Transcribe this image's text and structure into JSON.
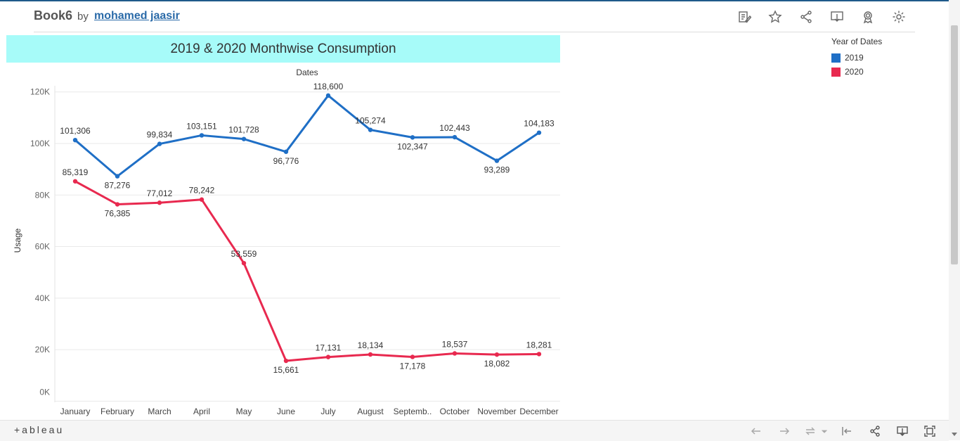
{
  "header": {
    "title": "Book6",
    "by": "by",
    "author": "mohamed jaasir"
  },
  "footer": {
    "logo_text": "+ableau"
  },
  "chart_data": {
    "type": "line",
    "title": "2019 & 2020 Monthwise Consumption",
    "xlabel": "Dates",
    "ylabel": "Usage",
    "categories": [
      "January",
      "February",
      "March",
      "April",
      "May",
      "June",
      "July",
      "August",
      "Septemb..",
      "October",
      "November",
      "December"
    ],
    "ylim": [
      0,
      120000
    ],
    "yticks": [
      0,
      20000,
      40000,
      60000,
      80000,
      100000,
      120000
    ],
    "ytick_labels": [
      "0K",
      "20K",
      "40K",
      "60K",
      "80K",
      "100K",
      "120K"
    ],
    "grid": true,
    "legend_title": "Year of Dates",
    "legend_position": "top-right",
    "series": [
      {
        "name": "2019",
        "color": "#1f6fc6",
        "values": [
          101306,
          87276,
          99834,
          103151,
          101728,
          96776,
          118600,
          105274,
          102347,
          102443,
          93289,
          104183
        ],
        "labels": [
          "101,306",
          "87,276",
          "99,834",
          "103,151",
          "101,728",
          "96,776",
          "118,600",
          "105,274",
          "102,347",
          "102,443",
          "93,289",
          "104,183"
        ]
      },
      {
        "name": "2020",
        "color": "#e8294f",
        "values": [
          85319,
          76385,
          77012,
          78242,
          53559,
          15661,
          17131,
          18134,
          17178,
          18537,
          18082,
          18281
        ],
        "labels": [
          "85,319",
          "76,385",
          "77,012",
          "78,242",
          "53,559",
          "15,661",
          "17,131",
          "18,134",
          "17,178",
          "18,537",
          "18,082",
          "18,281"
        ]
      }
    ]
  }
}
